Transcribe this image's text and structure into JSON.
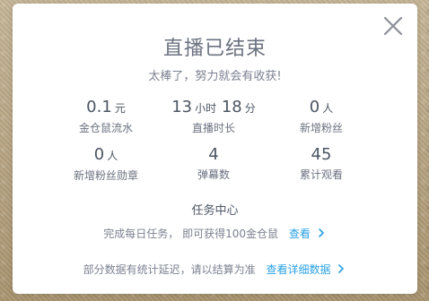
{
  "dialog": {
    "title": "直播已结束",
    "subtitle": "太棒了，努力就会有收获!"
  },
  "stats": [
    {
      "value": "0.1",
      "unit": "元",
      "label": "金仓鼠流水"
    },
    {
      "value_hours": "13",
      "unit_hours": "小时",
      "value_minutes": "18",
      "unit_minutes": "分",
      "label": "直播时长"
    },
    {
      "value": "0",
      "unit": "人",
      "label": "新增粉丝"
    },
    {
      "value": "0",
      "unit": "人",
      "label": "新增粉丝勋章"
    },
    {
      "value": "4",
      "unit": "",
      "label": "弹幕数"
    },
    {
      "value": "45",
      "unit": "",
      "label": "累计观看"
    }
  ],
  "task": {
    "title": "任务中心",
    "desc": "完成每日任务， 即可获得100金仓鼠",
    "link_label": "查看"
  },
  "footer": {
    "text": "部分数据有统计延迟，请以结算为准",
    "link_label": "查看详细数据"
  },
  "colors": {
    "accent": "#2aa1e4",
    "panel": "#ffffff",
    "text": "#4b5563"
  },
  "icons": {
    "close": "close-icon",
    "chevron": "chevron-right-icon"
  }
}
